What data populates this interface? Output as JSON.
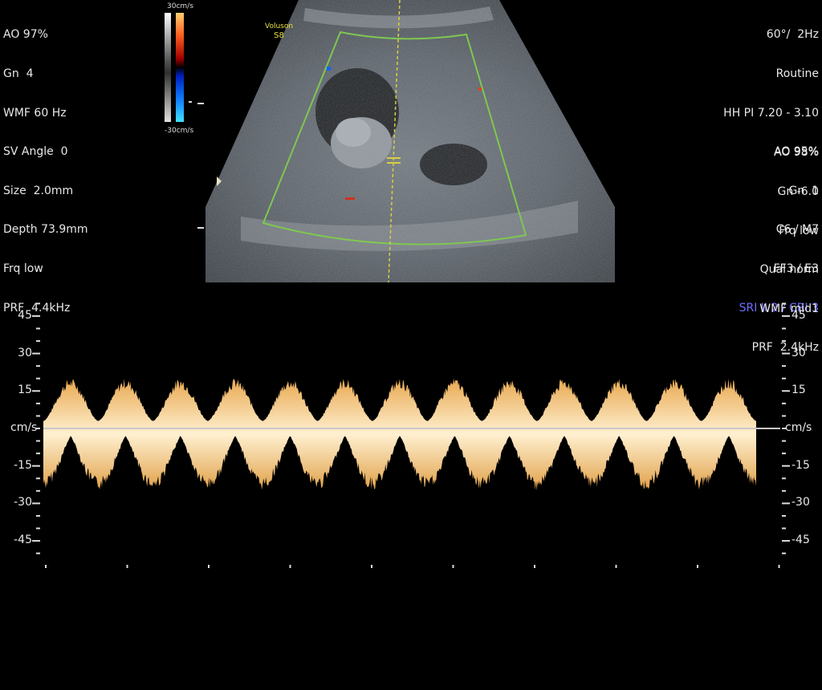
{
  "left_params": [
    "AO 97%",
    "Gn  4",
    "WMF 60 Hz",
    "SV Angle  0",
    "Size  2.0mm",
    "Depth 73.9mm",
    "Frq low",
    "PRF  4.4kHz"
  ],
  "right_params": [
    "60°/  2Hz",
    "Routine",
    "HH PI 7.20 - 3.10",
    "AO 95%",
    "Gn  1",
    "C6 / M7",
    "FF3 / E3"
  ],
  "right_params_highlight": "SRI II 2 / CRI 3",
  "right_params2": [
    "AO 98%",
    "Gn -6.0",
    "Frq low",
    "Qual norm",
    "WMF mid1",
    "PRF  2.4kHz"
  ],
  "colorbar": {
    "top_label": "30cm/s",
    "bottom_label": "-30cm/s"
  },
  "wordmark": {
    "line1": "Voluson",
    "line2": "S8"
  },
  "doppler": {
    "unit": "cm/s",
    "ticks": [
      "45",
      "30",
      "15",
      "-15",
      "-30",
      "-45"
    ]
  },
  "chart_data": {
    "type": "area",
    "ylabel": "cm/s",
    "ylim": [
      -55,
      50
    ],
    "yticks": [
      45,
      30,
      15,
      -15,
      -30,
      -45
    ],
    "cycles": 13,
    "peak_positive": 18,
    "peak_negative": -22
  },
  "colors": {
    "spectral": "#f2c27a",
    "baseline": "#c8c8c8",
    "sector": "#7ec850",
    "cursor": "#d8d040"
  }
}
